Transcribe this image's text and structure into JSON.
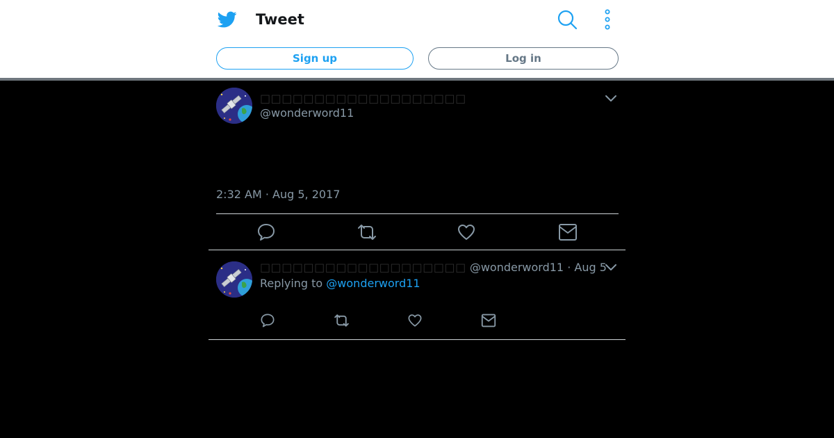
{
  "header": {
    "title": "Tweet",
    "signup_label": "Sign up",
    "login_label": "Log in",
    "logo_icon": "twitter-bird-icon",
    "search_icon": "search-icon",
    "more_icon": "more-vertical-icon",
    "brand_color": "#1da1f2"
  },
  "tweet": {
    "display_name": "□□□□□□□□□□□□□□□□□□□",
    "handle": "@wonderword11",
    "timestamp": "2:32 AM · Aug 5, 2017",
    "actions": [
      "reply-icon",
      "retweet-icon",
      "like-icon",
      "dm-icon"
    ]
  },
  "reply": {
    "display_name": "□□□□□□□□□□□□□□□□□□□",
    "handle": "@wonderword11",
    "separator": " · ",
    "date": "Aug 5",
    "replying_prefix": "Replying to ",
    "replying_handle": "@wonderword11"
  },
  "colors": {
    "background": "#000000",
    "muted_text": "#8899a6",
    "link": "#1da1f2",
    "login_border": "#657786"
  }
}
